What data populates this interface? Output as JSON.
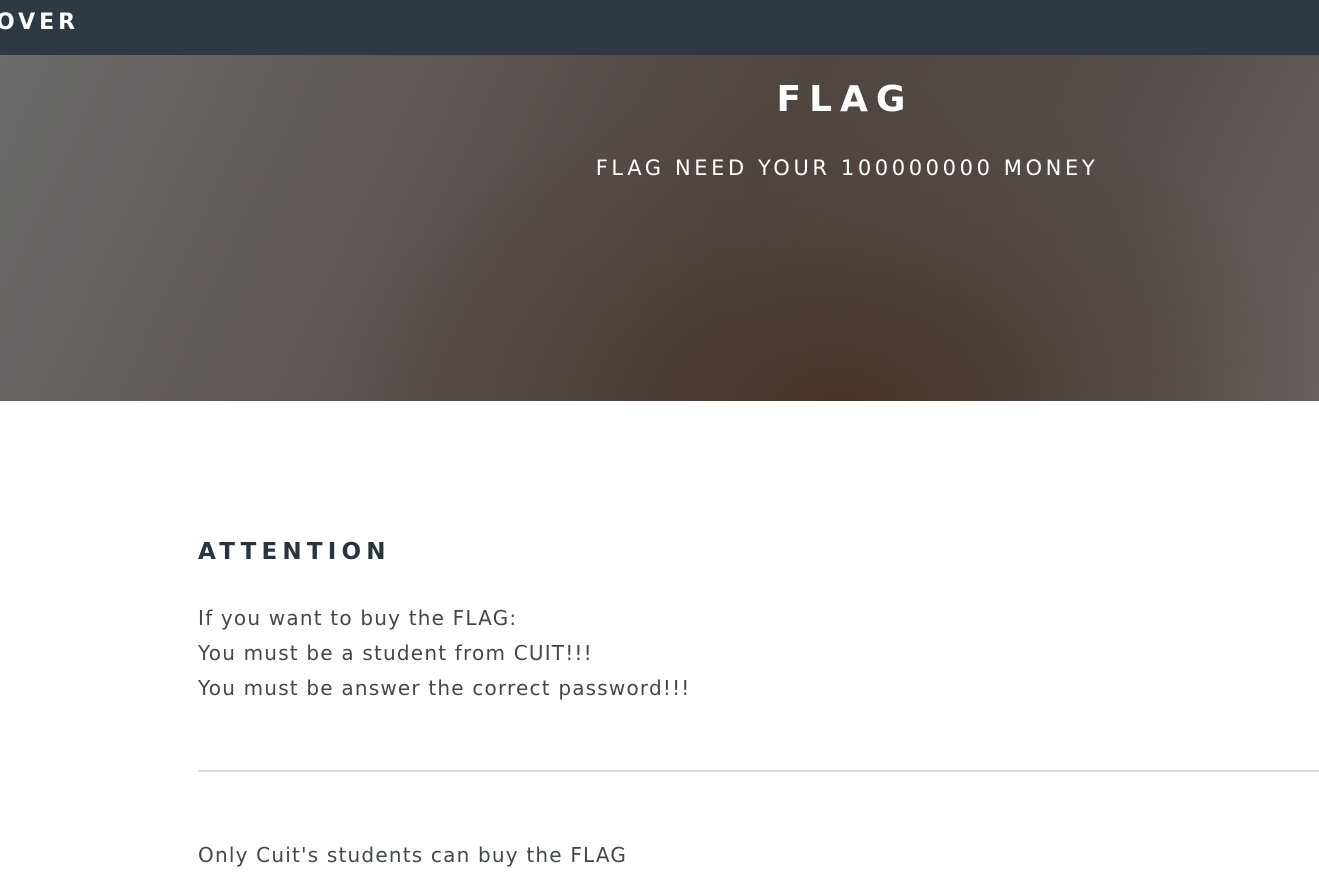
{
  "navbar": {
    "brand": "OVER",
    "background_color": "#2f3944"
  },
  "hero": {
    "title": "FLAG",
    "subtitle": "FLAG NEED YOUR 100000000 MONEY"
  },
  "attention": {
    "heading": "ATTENTION",
    "lines": [
      "If you want to buy the FLAG:",
      "You must be a student from CUIT!!!",
      "You must be answer the correct password!!!"
    ]
  },
  "note": {
    "text": "Only Cuit's students can buy the FLAG"
  }
}
